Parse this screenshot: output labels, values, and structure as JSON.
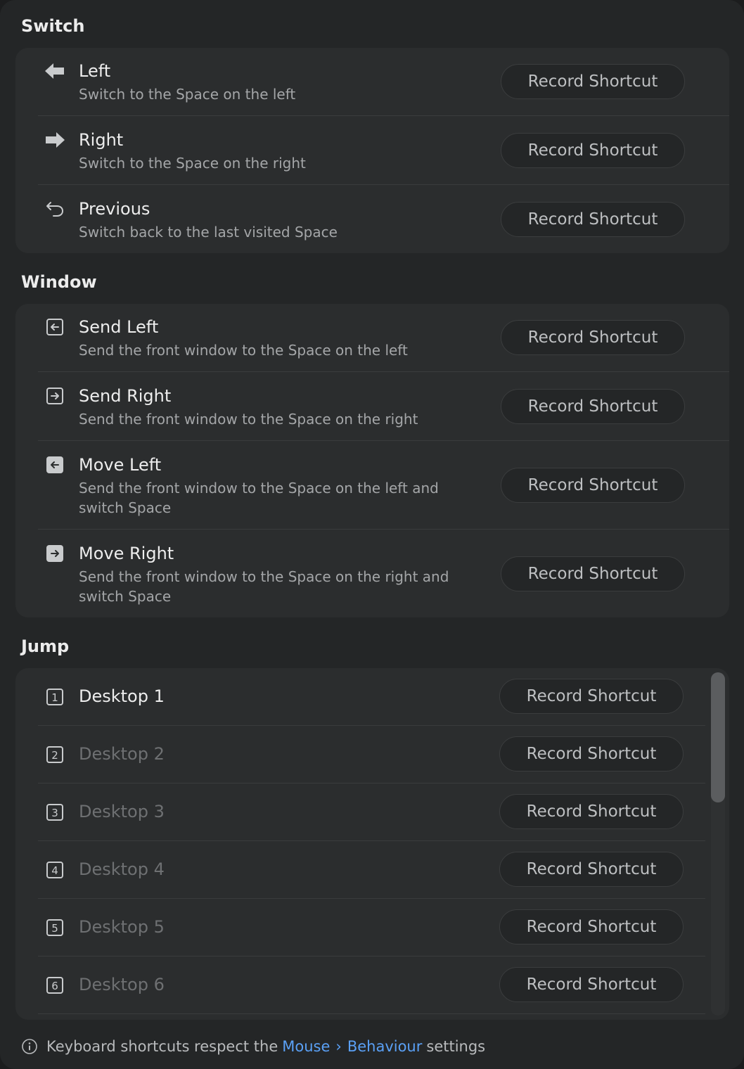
{
  "sections": {
    "switch": {
      "title": "Switch",
      "rows": [
        {
          "title": "Left",
          "desc": "Switch to the Space on the left",
          "button": "Record Shortcut",
          "icon": "arrow-left-filled-icon"
        },
        {
          "title": "Right",
          "desc": "Switch to the Space on the right",
          "button": "Record Shortcut",
          "icon": "arrow-right-filled-icon"
        },
        {
          "title": "Previous",
          "desc": "Switch back to the last visited Space",
          "button": "Record Shortcut",
          "icon": "return-arrow-icon"
        }
      ]
    },
    "window": {
      "title": "Window",
      "rows": [
        {
          "title": "Send Left",
          "desc": "Send the front window to the Space on the left",
          "button": "Record Shortcut",
          "icon": "square-arrow-left-icon"
        },
        {
          "title": "Send Right",
          "desc": "Send the front window to the Space on the right",
          "button": "Record Shortcut",
          "icon": "square-arrow-right-icon"
        },
        {
          "title": "Move Left",
          "desc": "Send the front window to the Space on the left and switch Space",
          "button": "Record Shortcut",
          "icon": "square-arrow-left-filled-icon"
        },
        {
          "title": "Move Right",
          "desc": "Send the front window to the Space on the right and switch Space",
          "button": "Record Shortcut",
          "icon": "square-arrow-right-filled-icon"
        }
      ]
    },
    "jump": {
      "title": "Jump",
      "rows": [
        {
          "number": "1",
          "title": "Desktop 1",
          "button": "Record Shortcut"
        },
        {
          "number": "2",
          "title": "Desktop 2",
          "button": "Record Shortcut"
        },
        {
          "number": "3",
          "title": "Desktop 3",
          "button": "Record Shortcut"
        },
        {
          "number": "4",
          "title": "Desktop 4",
          "button": "Record Shortcut"
        },
        {
          "number": "5",
          "title": "Desktop 5",
          "button": "Record Shortcut"
        },
        {
          "number": "6",
          "title": "Desktop 6",
          "button": "Record Shortcut"
        }
      ]
    }
  },
  "footer": {
    "text_before": "Keyboard shortcuts respect the",
    "link1": "Mouse",
    "separator": "›",
    "link2": "Behaviour",
    "text_after": "settings"
  },
  "colors": {
    "background": "#242627",
    "group": "#2b2d2e",
    "link": "#5aa0f5"
  }
}
